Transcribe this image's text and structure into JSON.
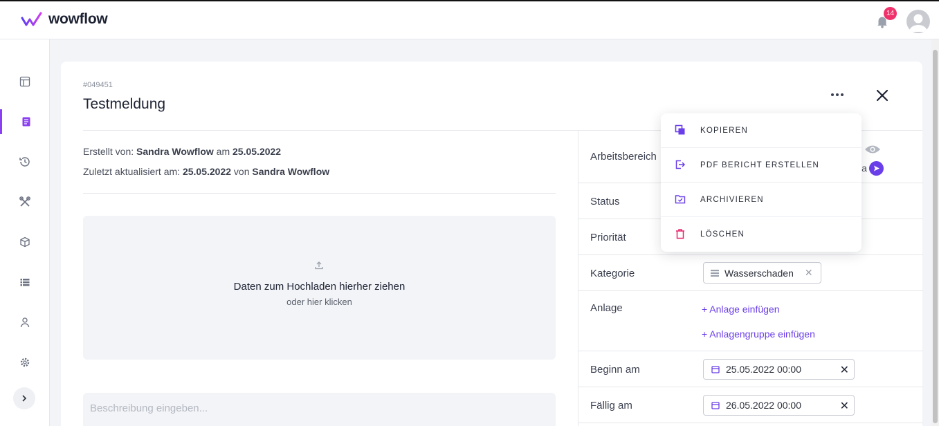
{
  "app": {
    "name": "wowflow",
    "brand_color": "#8a3ff0",
    "accent_color": "#6a3ee8"
  },
  "header": {
    "notification_count": "14"
  },
  "ticket": {
    "id": "#049451",
    "title": "Testmeldung",
    "created_prefix": "Erstellt von:",
    "created_by": "Sandra Wowflow",
    "created_on_word": "am",
    "created_date": "25.05.2022",
    "updated_prefix": "Zuletzt aktualisiert am:",
    "updated_date": "25.05.2022",
    "updated_by_word": "von",
    "updated_by": "Sandra Wowflow"
  },
  "upload": {
    "title": "Daten zum Hochladen hierher ziehen",
    "subtitle": "oder hier klicken"
  },
  "description": {
    "placeholder": "Beschreibung eingeben..."
  },
  "fields": {
    "arbeitsbereich_label": "Arbeitsbereich",
    "arbeitsbereich_partial": "ia",
    "status_label": "Status",
    "prioritaet_label": "Priorität",
    "kategorie_label": "Kategorie",
    "kategorie_value": "Wasserschaden",
    "anlage_label": "Anlage",
    "anlage_add": "+ Anlage einfügen",
    "anlagengruppe_add": "+ Anlagengruppe einfügen",
    "beginn_label": "Beginn am",
    "beginn_value": "25.05.2022 00:00",
    "faellig_label": "Fällig am",
    "faellig_value": "26.05.2022 00:00"
  },
  "menu": {
    "items": [
      {
        "label": "KOPIEREN",
        "icon": "copy-icon"
      },
      {
        "label": "PDF BERICHT ERSTELLEN",
        "icon": "export-icon"
      },
      {
        "label": "ARCHIVIEREN",
        "icon": "archive-icon"
      },
      {
        "label": "LÖSCHEN",
        "icon": "trash-icon"
      }
    ]
  },
  "sidebar": {
    "items": [
      {
        "icon": "dashboard-icon"
      },
      {
        "icon": "tickets-icon",
        "active": true
      },
      {
        "icon": "history-icon"
      },
      {
        "icon": "tools-icon"
      },
      {
        "icon": "box-icon"
      },
      {
        "icon": "list-icon"
      },
      {
        "icon": "user-icon"
      },
      {
        "icon": "settings-icon"
      }
    ]
  }
}
